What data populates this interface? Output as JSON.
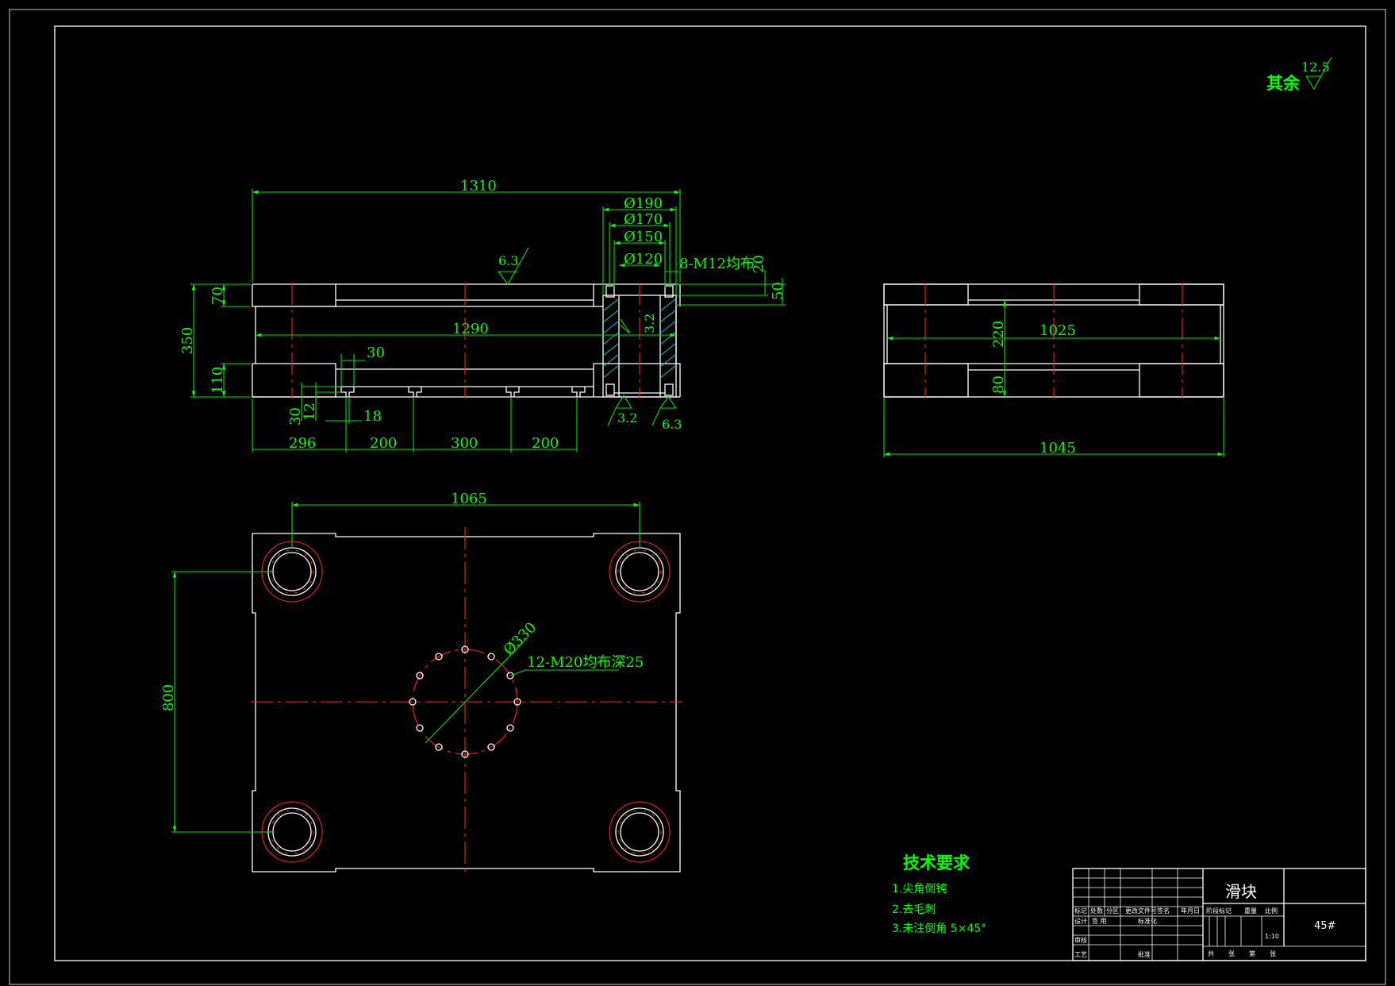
{
  "surface_finish": {
    "label": "其余",
    "value": "12.5"
  },
  "front_view": {
    "total_width": "1310",
    "bore_diameters": [
      "Ø190",
      "Ø170",
      "Ø150",
      "Ø120"
    ],
    "thread_note": "8-M12均布",
    "dim_20": "20",
    "dim_50": "50",
    "roughness_top": "6.3",
    "roughness_bore": "3.2",
    "dim_70": "70",
    "dim_350": "350",
    "inner_width": "1290",
    "dim_110": "110",
    "dim_30a": "30",
    "dim_30b": "30",
    "dim_12": "12",
    "dim_18": "18",
    "roughness_bottom_left": "3.2",
    "roughness_bottom_right": "6.3",
    "bottom_dims": [
      "296",
      "200",
      "300",
      "200"
    ]
  },
  "side_view": {
    "inner_width": "1025",
    "dim_220": "220",
    "dim_80": "80",
    "total_width": "1045"
  },
  "top_view": {
    "hole_spacing_x": "1065",
    "hole_spacing_y": "800",
    "pcd": "Ø330",
    "tapped_holes": "12-M20均布深25"
  },
  "tech_requirements": {
    "title": "技术要求",
    "items": [
      "1.尖角倒钝",
      "2.去毛刺",
      "3.未注倒角 5×45°"
    ]
  },
  "title_block": {
    "part_name": "滑块",
    "material": "45#",
    "scale": "1:10",
    "headers": [
      "标记",
      "处数",
      "分区",
      "更改文件号",
      "签名",
      "年月日"
    ],
    "row_labels": [
      "设计",
      "签 用",
      "标准化",
      "审核",
      "工艺",
      "批准"
    ],
    "stage_labels": [
      "阶段标记",
      "重量",
      "比例"
    ],
    "sheet_labels": [
      "共",
      "张",
      "第",
      "张"
    ]
  },
  "colors": {
    "background": "#000000",
    "outline": "#ffffff",
    "dimension": "#00ff00",
    "centerline": "#ff2020",
    "hatch": "#00c8c8"
  }
}
